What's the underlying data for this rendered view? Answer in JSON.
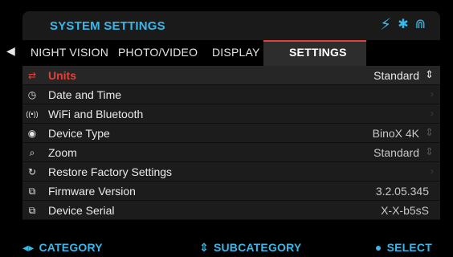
{
  "header": {
    "title": "SYSTEM SETTINGS"
  },
  "status": {
    "power_icon": "⚡",
    "bluetooth_icon": "✱",
    "wifi_icon": "⋒"
  },
  "tabs": [
    {
      "label": "NIGHT VISION"
    },
    {
      "label": "PHOTO/VIDEO"
    },
    {
      "label": "DISPLAY"
    },
    {
      "label": "SETTINGS"
    }
  ],
  "back_icon": "◀",
  "rows": [
    {
      "icon": "units-icon",
      "glyph": "⇄",
      "label": "Units",
      "value": "Standard",
      "caret": "⇕"
    },
    {
      "icon": "clock-icon",
      "glyph": "◷",
      "label": "Date and Time",
      "value": "",
      "caret": "›"
    },
    {
      "icon": "wifi-bluetooth-icon",
      "glyph": "((•))",
      "label": "WiFi and Bluetooth",
      "value": "",
      "caret": "›"
    },
    {
      "icon": "device-type-icon",
      "glyph": "◉",
      "label": "Device Type",
      "value": "BinoX 4K",
      "caret": "⇕"
    },
    {
      "icon": "zoom-icon",
      "glyph": "⌕",
      "label": "Zoom",
      "value": "Standard",
      "caret": "⇕"
    },
    {
      "icon": "restore-icon",
      "glyph": "↻",
      "label": "Restore Factory Settings",
      "value": "",
      "caret": "›"
    },
    {
      "icon": "firmware-chip-icon",
      "glyph": "⧉",
      "label": "Firmware Version",
      "value": "3.2.05.345",
      "caret": ""
    },
    {
      "icon": "serial-chip-icon",
      "glyph": "⧉",
      "label": "Device Serial",
      "value": "X-X-b5sS",
      "caret": ""
    }
  ],
  "footer": {
    "category_glyph": "◂▸",
    "category": "CATEGORY",
    "subcategory_glyph": "⇕",
    "subcategory": "SUBCATEGORY",
    "select_glyph": "●",
    "select": "SELECT"
  },
  "colors": {
    "accent": "#38b8e8",
    "highlight": "#e2403a",
    "row_bg": "#1c1c1c"
  }
}
